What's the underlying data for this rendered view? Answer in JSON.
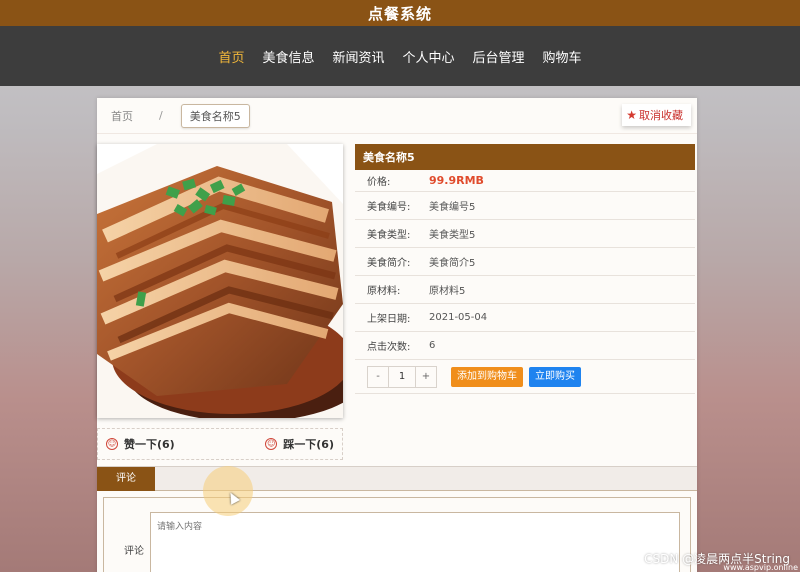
{
  "header": {
    "title": "点餐系统"
  },
  "nav": {
    "items": [
      "首页",
      "美食信息",
      "新闻资讯",
      "个人中心",
      "后台管理",
      "购物车"
    ],
    "active_index": 0
  },
  "breadcrumb": {
    "home": "首页",
    "separator": "/",
    "current": "美食名称5"
  },
  "favorite": {
    "label": "取消收藏",
    "icon": "star-icon"
  },
  "product": {
    "name": "美食名称5",
    "price_label": "价格:",
    "price_value": "99.9RMB",
    "fields": [
      {
        "label": "美食编号:",
        "value": "美食编号5"
      },
      {
        "label": "美食类型:",
        "value": "美食类型5"
      },
      {
        "label": "美食简介:",
        "value": "美食简介5"
      },
      {
        "label": "原材料:",
        "value": "原材料5"
      },
      {
        "label": "上架日期:",
        "value": "2021-05-04"
      },
      {
        "label": "点击次数:",
        "value": "6"
      }
    ],
    "quantity": "1",
    "minus": "-",
    "plus": "+",
    "add_to_cart": "添加到购物车",
    "buy_now": "立即购买",
    "image": {
      "icon": "braised-pork-dish-photo"
    }
  },
  "votes": {
    "like": "赞一下(6)",
    "dislike": "踩一下(6)"
  },
  "comments": {
    "tab": "评论",
    "label": "评论",
    "placeholder": "请输入内容"
  },
  "watermark": {
    "line1": "CSDN @凌晨两点半String",
    "line2": "www.aspvip.online"
  },
  "colors": {
    "brand": "#8a5315",
    "active_nav": "#f2b83a",
    "price": "#e04b2c",
    "cart_button": "#f08e1b",
    "buy_button": "#1f83ef"
  }
}
